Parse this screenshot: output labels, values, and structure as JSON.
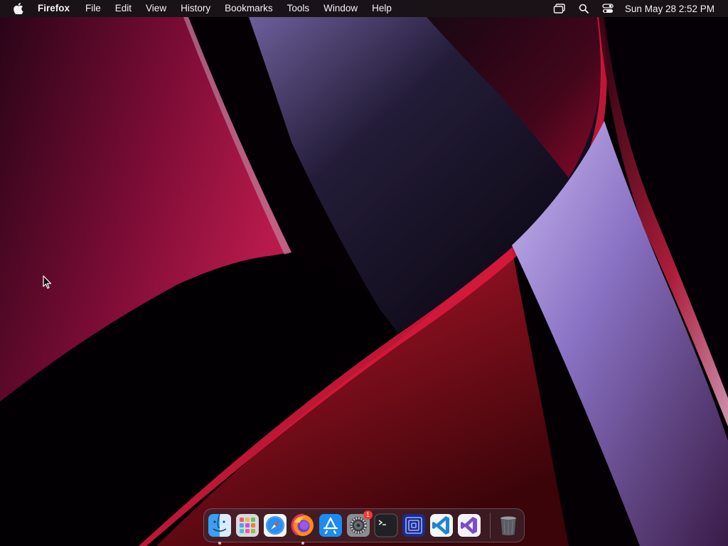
{
  "menubar": {
    "apple_icon": "apple-logo-icon",
    "app_name": "Firefox",
    "menus": [
      "File",
      "Edit",
      "View",
      "History",
      "Bookmarks",
      "Tools",
      "Window",
      "Help"
    ],
    "status_icons": [
      "screen-mirroring-icon",
      "spotlight-search-icon",
      "control-center-icon"
    ],
    "clock": "Sun May 28  2:52 PM"
  },
  "dock": {
    "apps": [
      {
        "name": "finder-icon",
        "running": true
      },
      {
        "name": "launchpad-icon",
        "running": false
      },
      {
        "name": "safari-icon",
        "running": false
      },
      {
        "name": "firefox-icon",
        "running": true
      },
      {
        "name": "app-store-icon",
        "running": false
      },
      {
        "name": "system-settings-icon",
        "running": false,
        "badge": "1"
      },
      {
        "name": "terminal-icon",
        "running": false
      },
      {
        "name": "blue-square-app-icon",
        "running": false
      },
      {
        "name": "vscode-icon",
        "running": false
      },
      {
        "name": "visual-studio-icon",
        "running": false
      }
    ],
    "trash": {
      "name": "trash-icon"
    }
  },
  "colors": {
    "wallpaper_red": "#a0123c",
    "wallpaper_violet": "#9a85c8",
    "menubar_bg": "#1e161c",
    "badge_red": "#ef3a33"
  }
}
